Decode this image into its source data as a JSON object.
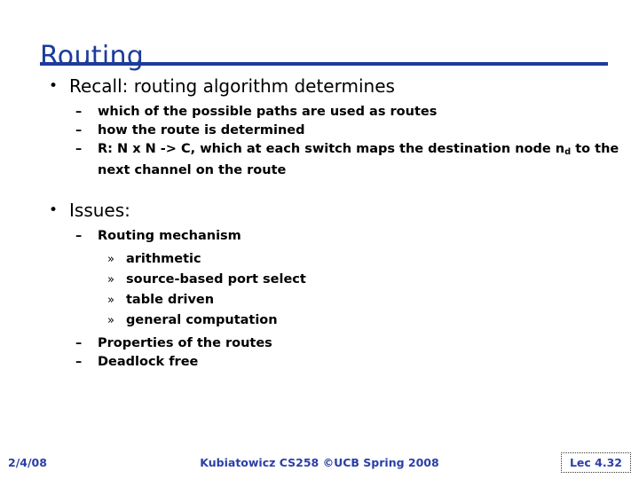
{
  "slide": {
    "title": "Routing",
    "accent_color": "#1B3C9B",
    "body_color": "#000000",
    "footer_color": "#2B3FA8",
    "background_color": "#FFFFFF"
  },
  "markers": {
    "level1": "•",
    "level2": "–",
    "level3": "»"
  },
  "content": {
    "block1": {
      "heading": "Recall: routing algorithm determines",
      "items": [
        "which of the possible paths are used as routes",
        "how the route is determined"
      ],
      "item3_pre": "R: N x N -> C, which at each switch maps the destination node n",
      "item3_sub": "d",
      "item3_post": " to the next channel on the route"
    },
    "block2": {
      "heading": "Issues:",
      "item1": "Routing mechanism",
      "subitems": [
        "arithmetic",
        "source-based port select",
        "table driven",
        "general computation"
      ],
      "item2": "Properties of the routes",
      "item3": "Deadlock free"
    }
  },
  "footer": {
    "date": "2/4/08",
    "credit": "Kubiatowicz CS258 ©UCB Spring 2008",
    "lecture": "Lec 4.32"
  }
}
